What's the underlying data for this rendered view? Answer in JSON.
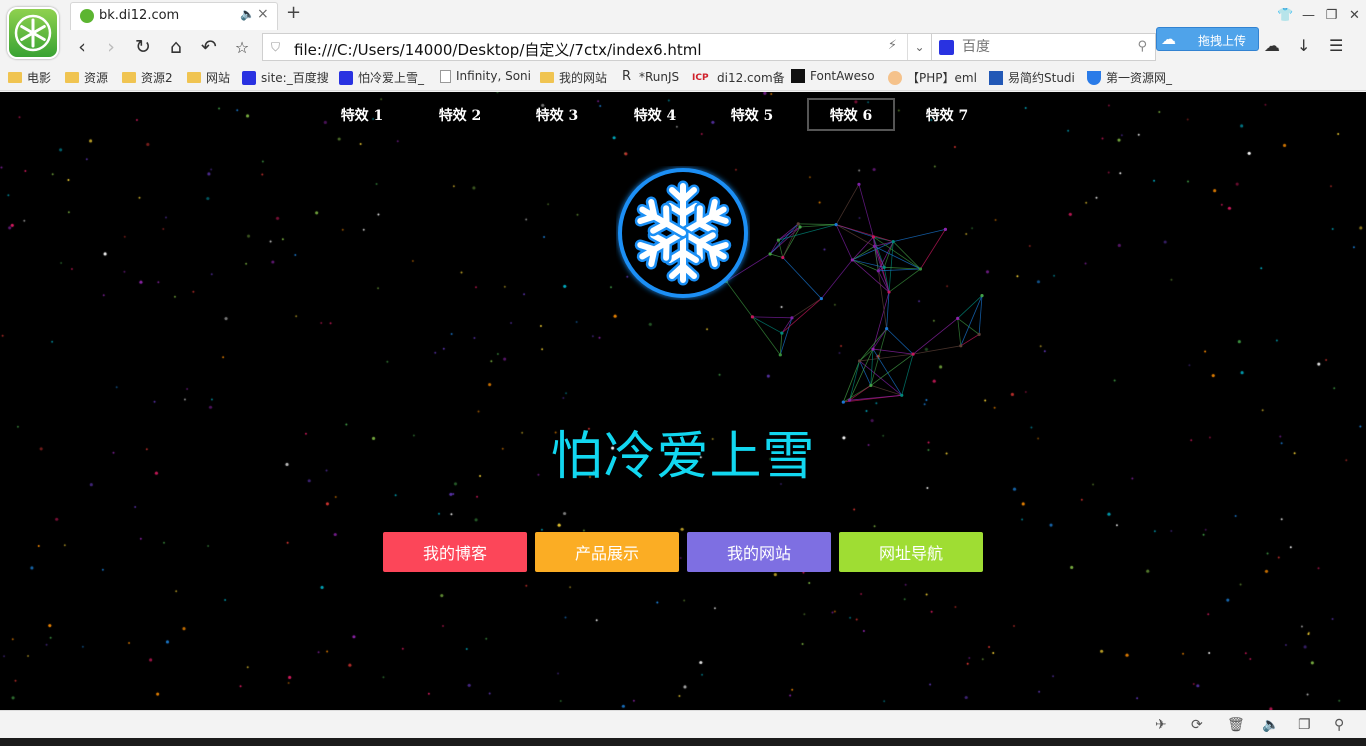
{
  "browser": {
    "tab_title": "bk.di12.com",
    "tab_audio_icon": "speaker-icon",
    "tab_close": "×",
    "new_tab": "+",
    "address": "file:///C:/Users/14000/Desktop/自定义/7ctx/index6.html",
    "search_placeholder": "百度",
    "upload_label": "拖拽上传",
    "bookmarks": [
      {
        "label": "电影",
        "icon": "folder"
      },
      {
        "label": "资源",
        "icon": "folder"
      },
      {
        "label": "资源2",
        "icon": "folder"
      },
      {
        "label": "网站",
        "icon": "folder"
      },
      {
        "label": "site:_百度搜",
        "icon": "paw"
      },
      {
        "label": "怕冷爱上雪_",
        "icon": "paw"
      },
      {
        "label": "Infinity, Soni",
        "icon": "page"
      },
      {
        "label": "我的网站",
        "icon": "folder"
      },
      {
        "label": "*RunJS",
        "icon": "r"
      },
      {
        "label": "di12.com备",
        "icon": "icp"
      },
      {
        "label": "FontAweso",
        "icon": "flag"
      },
      {
        "label": "【PHP】eml",
        "icon": "face"
      },
      {
        "label": "易简约Studi",
        "icon": "easy"
      },
      {
        "label": "第一资源网_",
        "icon": "shield"
      }
    ]
  },
  "page": {
    "effect_tabs": [
      "特效 1",
      "特效 2",
      "特效 3",
      "特效 4",
      "特效 5",
      "特效 6",
      "特效 7"
    ],
    "active_tab": "特效 6",
    "site_title": "怕冷爱上雪",
    "buttons": [
      {
        "label": "我的博客",
        "color": "#fc4659"
      },
      {
        "label": "产品展示",
        "color": "#fbad24"
      },
      {
        "label": "我的网站",
        "color": "#7e6fe2"
      },
      {
        "label": "网址导航",
        "color": "#9fdd33"
      }
    ],
    "colors": {
      "title": "#12d7f0",
      "logo_ring": "#1a8ff5",
      "background": "#000000"
    }
  }
}
